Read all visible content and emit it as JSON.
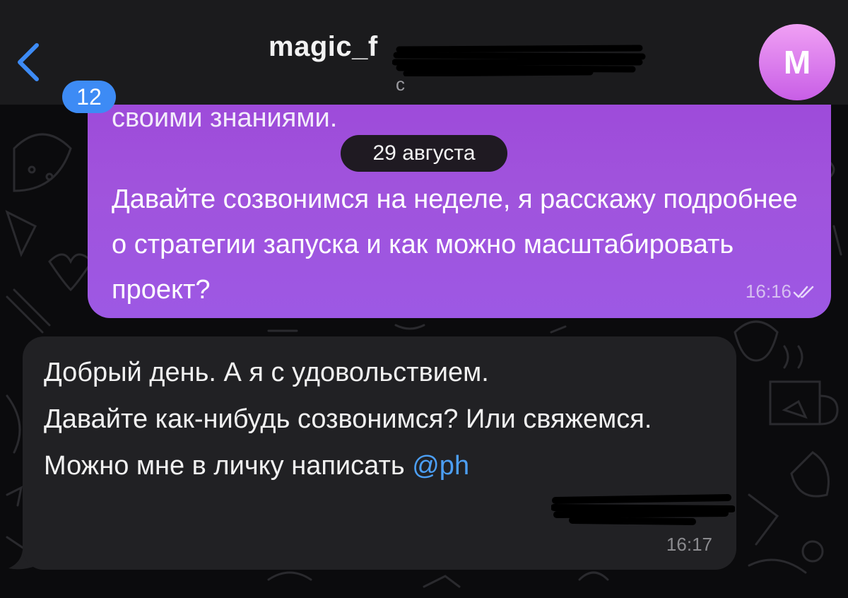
{
  "header": {
    "unread_count": "12",
    "title": "magic_f",
    "subtitle": "c",
    "avatar_initial": "M"
  },
  "messages": {
    "outgoing_cut_text": "своими знаниями.",
    "date_separator": "29 августа",
    "outgoing_text": "Давайте созвонимся на неделе, я расскажу подробнее о стратегии запуска и как можно масштабировать проект?",
    "outgoing_time": "16:16",
    "incoming_line1": "Добрый день. А я с удовольствием.",
    "incoming_line2": "Давайте как-нибудь созвонимся? Или свяжемся.",
    "incoming_line3_prefix": "Можно мне в личку написать ",
    "incoming_mention": "@ph",
    "incoming_time": "16:17"
  },
  "colors": {
    "outgoing_bubble": "#9d48d9",
    "incoming_bubble": "#212124",
    "accent": "#3d8bf5",
    "mention": "#4c9ff5"
  },
  "icons": {
    "back": "chevron-left-icon",
    "read_status": "double-check-icon"
  }
}
